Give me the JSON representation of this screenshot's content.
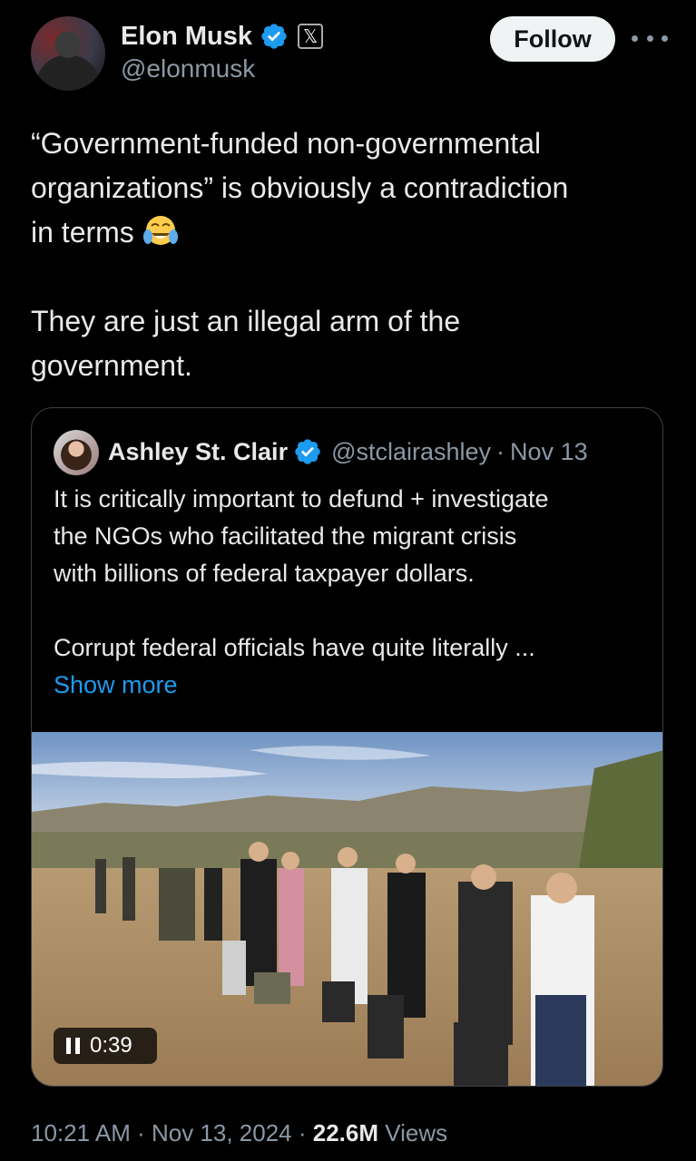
{
  "author": {
    "display_name": "Elon Musk",
    "handle": "@elonmusk",
    "verified_icon": "verified-badge-icon",
    "affiliation_icon": "x-logo-icon",
    "affiliation_glyph": "𝕏"
  },
  "actions": {
    "follow_label": "Follow",
    "more_icon": "more-horizontal-icon"
  },
  "tweet": {
    "line1": "“Government-funded non-governmental",
    "line2": "organizations” is obviously a contradiction",
    "line3": "in terms",
    "emoji": "face-with-tears-of-joy",
    "line4": "They are just an illegal arm of the",
    "line5": "government."
  },
  "quote": {
    "display_name": "Ashley St. Clair",
    "handle": "@stclairashley",
    "separator": "·",
    "date": "Nov 13",
    "line1": "It is critically important to defund + investigate",
    "line2": "the NGOs who facilitated the migrant crisis",
    "line3": "with billions of federal taxpayer dollars.",
    "line4": "Corrupt federal officials have quite literally ...",
    "show_more": "Show more",
    "video": {
      "time": "0:39",
      "pause_icon": "pause-icon"
    }
  },
  "meta": {
    "time": "10:21 AM",
    "sep1": " · ",
    "date": "Nov 13, 2024",
    "sep2": " · ",
    "views_count": "22.6M",
    "views_label": " Views"
  },
  "colors": {
    "background": "#000000",
    "text": "#e7e9ea",
    "secondary": "#8b98a5",
    "link": "#1d9bf0",
    "border": "#3b4147"
  }
}
